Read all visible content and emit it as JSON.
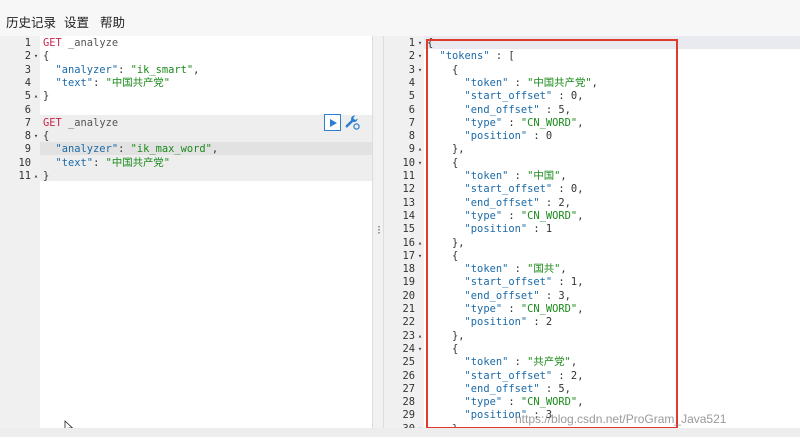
{
  "menu": {
    "items": [
      "历史记录",
      "设置",
      "帮助"
    ]
  },
  "request_editor": {
    "lines": [
      {
        "n": "1",
        "f": "",
        "t": [
          {
            "c": "k-method",
            "v": "GET"
          },
          {
            "c": "k-path",
            "v": " _analyze"
          }
        ]
      },
      {
        "n": "2",
        "f": "▾",
        "t": [
          {
            "c": "k-brace",
            "v": "{"
          }
        ]
      },
      {
        "n": "3",
        "f": "",
        "t": [
          {
            "c": "",
            "v": "  "
          },
          {
            "c": "k-key",
            "v": "\"analyzer\""
          },
          {
            "c": "k-punc",
            "v": ": "
          },
          {
            "c": "k-str",
            "v": "\"ik_smart\""
          },
          {
            "c": "k-punc",
            "v": ","
          }
        ]
      },
      {
        "n": "4",
        "f": "",
        "t": [
          {
            "c": "",
            "v": "  "
          },
          {
            "c": "k-key",
            "v": "\"text\""
          },
          {
            "c": "k-punc",
            "v": ": "
          },
          {
            "c": "k-str",
            "v": "\"中国共产党\""
          }
        ]
      },
      {
        "n": "5",
        "f": "▴",
        "t": [
          {
            "c": "k-brace",
            "v": "}"
          }
        ]
      },
      {
        "n": "6",
        "f": "",
        "t": []
      },
      {
        "n": "7",
        "f": "",
        "t": [
          {
            "c": "k-method",
            "v": "GET"
          },
          {
            "c": "k-path",
            "v": " _analyze"
          }
        ]
      },
      {
        "n": "8",
        "f": "▾",
        "t": [
          {
            "c": "k-brace",
            "v": "{"
          }
        ]
      },
      {
        "n": "9",
        "f": "",
        "t": [
          {
            "c": "",
            "v": "  "
          },
          {
            "c": "k-key",
            "v": "\"analyzer\""
          },
          {
            "c": "k-punc",
            "v": ": "
          },
          {
            "c": "k-str",
            "v": "\"ik_max_word\""
          },
          {
            "c": "k-punc",
            "v": ","
          }
        ]
      },
      {
        "n": "10",
        "f": "",
        "t": [
          {
            "c": "",
            "v": "  "
          },
          {
            "c": "k-key",
            "v": "\"text\""
          },
          {
            "c": "k-punc",
            "v": ": "
          },
          {
            "c": "k-str",
            "v": "\"中国共产党\""
          }
        ]
      },
      {
        "n": "11",
        "f": "▴",
        "t": [
          {
            "c": "k-brace",
            "v": "}"
          }
        ]
      }
    ]
  },
  "response_editor": {
    "lines": [
      {
        "n": "1",
        "f": "▾",
        "t": [
          {
            "c": "k-brace",
            "v": "{"
          }
        ]
      },
      {
        "n": "2",
        "f": "▾",
        "t": [
          {
            "c": "",
            "v": "  "
          },
          {
            "c": "k-key",
            "v": "\"tokens\""
          },
          {
            "c": "k-punc",
            "v": " : ["
          }
        ]
      },
      {
        "n": "3",
        "f": "▾",
        "t": [
          {
            "c": "",
            "v": "    "
          },
          {
            "c": "k-brace",
            "v": "{"
          }
        ]
      },
      {
        "n": "4",
        "f": "",
        "t": [
          {
            "c": "",
            "v": "      "
          },
          {
            "c": "k-key",
            "v": "\"token\""
          },
          {
            "c": "k-punc",
            "v": " : "
          },
          {
            "c": "k-str",
            "v": "\"中国共产党\""
          },
          {
            "c": "k-punc",
            "v": ","
          }
        ]
      },
      {
        "n": "5",
        "f": "",
        "t": [
          {
            "c": "",
            "v": "      "
          },
          {
            "c": "k-key",
            "v": "\"start_offset\""
          },
          {
            "c": "k-punc",
            "v": " : "
          },
          {
            "c": "k-num",
            "v": "0"
          },
          {
            "c": "k-punc",
            "v": ","
          }
        ]
      },
      {
        "n": "6",
        "f": "",
        "t": [
          {
            "c": "",
            "v": "      "
          },
          {
            "c": "k-key",
            "v": "\"end_offset\""
          },
          {
            "c": "k-punc",
            "v": " : "
          },
          {
            "c": "k-num",
            "v": "5"
          },
          {
            "c": "k-punc",
            "v": ","
          }
        ]
      },
      {
        "n": "7",
        "f": "",
        "t": [
          {
            "c": "",
            "v": "      "
          },
          {
            "c": "k-key",
            "v": "\"type\""
          },
          {
            "c": "k-punc",
            "v": " : "
          },
          {
            "c": "k-str",
            "v": "\"CN_WORD\""
          },
          {
            "c": "k-punc",
            "v": ","
          }
        ]
      },
      {
        "n": "8",
        "f": "",
        "t": [
          {
            "c": "",
            "v": "      "
          },
          {
            "c": "k-key",
            "v": "\"position\""
          },
          {
            "c": "k-punc",
            "v": " : "
          },
          {
            "c": "k-num",
            "v": "0"
          }
        ]
      },
      {
        "n": "9",
        "f": "▴",
        "t": [
          {
            "c": "",
            "v": "    "
          },
          {
            "c": "k-brace",
            "v": "},"
          }
        ]
      },
      {
        "n": "10",
        "f": "▾",
        "t": [
          {
            "c": "",
            "v": "    "
          },
          {
            "c": "k-brace",
            "v": "{"
          }
        ]
      },
      {
        "n": "11",
        "f": "",
        "t": [
          {
            "c": "",
            "v": "      "
          },
          {
            "c": "k-key",
            "v": "\"token\""
          },
          {
            "c": "k-punc",
            "v": " : "
          },
          {
            "c": "k-str",
            "v": "\"中国\""
          },
          {
            "c": "k-punc",
            "v": ","
          }
        ]
      },
      {
        "n": "12",
        "f": "",
        "t": [
          {
            "c": "",
            "v": "      "
          },
          {
            "c": "k-key",
            "v": "\"start_offset\""
          },
          {
            "c": "k-punc",
            "v": " : "
          },
          {
            "c": "k-num",
            "v": "0"
          },
          {
            "c": "k-punc",
            "v": ","
          }
        ]
      },
      {
        "n": "13",
        "f": "",
        "t": [
          {
            "c": "",
            "v": "      "
          },
          {
            "c": "k-key",
            "v": "\"end_offset\""
          },
          {
            "c": "k-punc",
            "v": " : "
          },
          {
            "c": "k-num",
            "v": "2"
          },
          {
            "c": "k-punc",
            "v": ","
          }
        ]
      },
      {
        "n": "14",
        "f": "",
        "t": [
          {
            "c": "",
            "v": "      "
          },
          {
            "c": "k-key",
            "v": "\"type\""
          },
          {
            "c": "k-punc",
            "v": " : "
          },
          {
            "c": "k-str",
            "v": "\"CN_WORD\""
          },
          {
            "c": "k-punc",
            "v": ","
          }
        ]
      },
      {
        "n": "15",
        "f": "",
        "t": [
          {
            "c": "",
            "v": "      "
          },
          {
            "c": "k-key",
            "v": "\"position\""
          },
          {
            "c": "k-punc",
            "v": " : "
          },
          {
            "c": "k-num",
            "v": "1"
          }
        ]
      },
      {
        "n": "16",
        "f": "▴",
        "t": [
          {
            "c": "",
            "v": "    "
          },
          {
            "c": "k-brace",
            "v": "},"
          }
        ]
      },
      {
        "n": "17",
        "f": "▾",
        "t": [
          {
            "c": "",
            "v": "    "
          },
          {
            "c": "k-brace",
            "v": "{"
          }
        ]
      },
      {
        "n": "18",
        "f": "",
        "t": [
          {
            "c": "",
            "v": "      "
          },
          {
            "c": "k-key",
            "v": "\"token\""
          },
          {
            "c": "k-punc",
            "v": " : "
          },
          {
            "c": "k-str",
            "v": "\"国共\""
          },
          {
            "c": "k-punc",
            "v": ","
          }
        ]
      },
      {
        "n": "19",
        "f": "",
        "t": [
          {
            "c": "",
            "v": "      "
          },
          {
            "c": "k-key",
            "v": "\"start_offset\""
          },
          {
            "c": "k-punc",
            "v": " : "
          },
          {
            "c": "k-num",
            "v": "1"
          },
          {
            "c": "k-punc",
            "v": ","
          }
        ]
      },
      {
        "n": "20",
        "f": "",
        "t": [
          {
            "c": "",
            "v": "      "
          },
          {
            "c": "k-key",
            "v": "\"end_offset\""
          },
          {
            "c": "k-punc",
            "v": " : "
          },
          {
            "c": "k-num",
            "v": "3"
          },
          {
            "c": "k-punc",
            "v": ","
          }
        ]
      },
      {
        "n": "21",
        "f": "",
        "t": [
          {
            "c": "",
            "v": "      "
          },
          {
            "c": "k-key",
            "v": "\"type\""
          },
          {
            "c": "k-punc",
            "v": " : "
          },
          {
            "c": "k-str",
            "v": "\"CN_WORD\""
          },
          {
            "c": "k-punc",
            "v": ","
          }
        ]
      },
      {
        "n": "22",
        "f": "",
        "t": [
          {
            "c": "",
            "v": "      "
          },
          {
            "c": "k-key",
            "v": "\"position\""
          },
          {
            "c": "k-punc",
            "v": " : "
          },
          {
            "c": "k-num",
            "v": "2"
          }
        ]
      },
      {
        "n": "23",
        "f": "▴",
        "t": [
          {
            "c": "",
            "v": "    "
          },
          {
            "c": "k-brace",
            "v": "},"
          }
        ]
      },
      {
        "n": "24",
        "f": "▾",
        "t": [
          {
            "c": "",
            "v": "    "
          },
          {
            "c": "k-brace",
            "v": "{"
          }
        ]
      },
      {
        "n": "25",
        "f": "",
        "t": [
          {
            "c": "",
            "v": "      "
          },
          {
            "c": "k-key",
            "v": "\"token\""
          },
          {
            "c": "k-punc",
            "v": " : "
          },
          {
            "c": "k-str",
            "v": "\"共产党\""
          },
          {
            "c": "k-punc",
            "v": ","
          }
        ]
      },
      {
        "n": "26",
        "f": "",
        "t": [
          {
            "c": "",
            "v": "      "
          },
          {
            "c": "k-key",
            "v": "\"start_offset\""
          },
          {
            "c": "k-punc",
            "v": " : "
          },
          {
            "c": "k-num",
            "v": "2"
          },
          {
            "c": "k-punc",
            "v": ","
          }
        ]
      },
      {
        "n": "27",
        "f": "",
        "t": [
          {
            "c": "",
            "v": "      "
          },
          {
            "c": "k-key",
            "v": "\"end_offset\""
          },
          {
            "c": "k-punc",
            "v": " : "
          },
          {
            "c": "k-num",
            "v": "5"
          },
          {
            "c": "k-punc",
            "v": ","
          }
        ]
      },
      {
        "n": "28",
        "f": "",
        "t": [
          {
            "c": "",
            "v": "      "
          },
          {
            "c": "k-key",
            "v": "\"type\""
          },
          {
            "c": "k-punc",
            "v": " : "
          },
          {
            "c": "k-str",
            "v": "\"CN_WORD\""
          },
          {
            "c": "k-punc",
            "v": ","
          }
        ]
      },
      {
        "n": "29",
        "f": "",
        "t": [
          {
            "c": "",
            "v": "      "
          },
          {
            "c": "k-key",
            "v": "\"position\""
          },
          {
            "c": "k-punc",
            "v": " : "
          },
          {
            "c": "k-num",
            "v": "3"
          }
        ]
      },
      {
        "n": "30",
        "f": "▾",
        "t": [
          {
            "c": "",
            "v": "    "
          },
          {
            "c": "k-brace",
            "v": "}"
          }
        ]
      }
    ]
  },
  "icons": {
    "send_request": "play-icon",
    "settings": "wrench-icon",
    "splitter": "vertical-dots-icon",
    "cursor": "mouse-pointer-icon"
  },
  "colors": {
    "highlight_border": "#e03a2f",
    "method": "#c7254e",
    "key": "#1a6aa8",
    "string": "#1a8a1a"
  },
  "watermark": "https://blog.csdn.net/ProGram_Java521"
}
